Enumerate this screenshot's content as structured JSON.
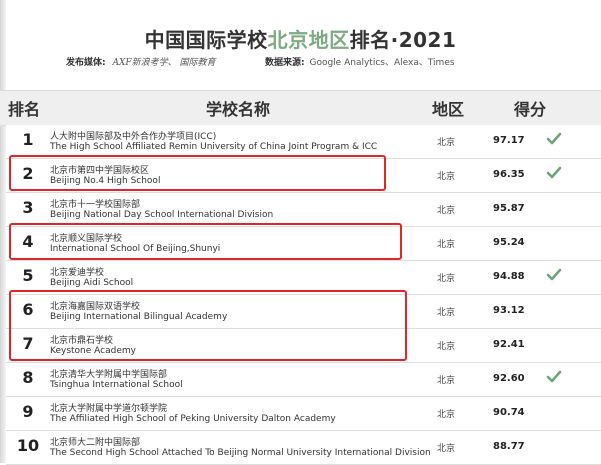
{
  "title_pre": "中国国际学校",
  "title_highlight": "北京地区",
  "title_post": "排名·2021",
  "media_label": "发布媒体:",
  "media_value": "AXF新浪考学、  国际教育",
  "source_label": "数据来源:",
  "source_value": "Google Analytics、Alexa、Times",
  "headers": {
    "rank": "排名",
    "school": "学校名称",
    "region": "地区",
    "score": "得分"
  },
  "rows": [
    {
      "rank": "1",
      "cn": "人大附中国际部及中外合作办学项目(ICC)",
      "en": "The High School Affiliated Remin University of China Joint Program & ICC",
      "region": "北京",
      "score": "97.17",
      "check": true,
      "highlight": false
    },
    {
      "rank": "2",
      "cn": "北京市第四中学国际校区",
      "en": "Beijing No.4 High School",
      "region": "北京",
      "score": "96.35",
      "check": true,
      "highlight": true
    },
    {
      "rank": "3",
      "cn": "北京市十一学校国际部",
      "en": "Beijing National Day School International Division",
      "region": "北京",
      "score": "95.87",
      "check": false,
      "highlight": false
    },
    {
      "rank": "4",
      "cn": "北京顺义国际学校",
      "en": "International School Of Beijing,Shunyi",
      "region": "北京",
      "score": "95.24",
      "check": false,
      "highlight": true
    },
    {
      "rank": "5",
      "cn": "北京爱迪学校",
      "en": "Beijing Aidi School",
      "region": "北京",
      "score": "94.88",
      "check": true,
      "highlight": false
    },
    {
      "rank": "6",
      "cn": "北京海嘉国际双语学校",
      "en": "Beijing International Bilingual Academy",
      "region": "北京",
      "score": "93.12",
      "check": false,
      "highlight": true
    },
    {
      "rank": "7",
      "cn": "北京市鼎石学校",
      "en": "Keystone Academy",
      "region": "北京",
      "score": "92.41",
      "check": false,
      "highlight": true
    },
    {
      "rank": "8",
      "cn": "北京清华大学附属中学国际部",
      "en": "Tsinghua International School",
      "region": "北京",
      "score": "92.60",
      "check": true,
      "highlight": false
    },
    {
      "rank": "9",
      "cn": "北京大学附属中学道尔顿学院",
      "en": "The Affiliated High School of Peking University Dalton Academy",
      "region": "北京",
      "score": "90.74",
      "check": false,
      "highlight": false
    },
    {
      "rank": "10",
      "cn": "北京师大二附中国际部",
      "en": "The Second High School Attached To Beijing Normal University International Division",
      "region": "北京",
      "score": "88.77",
      "check": false,
      "highlight": false
    }
  ],
  "colors": {
    "highlight_title": "#7cab82",
    "checkmark": "#6fa477",
    "red_box": "#e0262a",
    "header_bg": "#efefef"
  }
}
